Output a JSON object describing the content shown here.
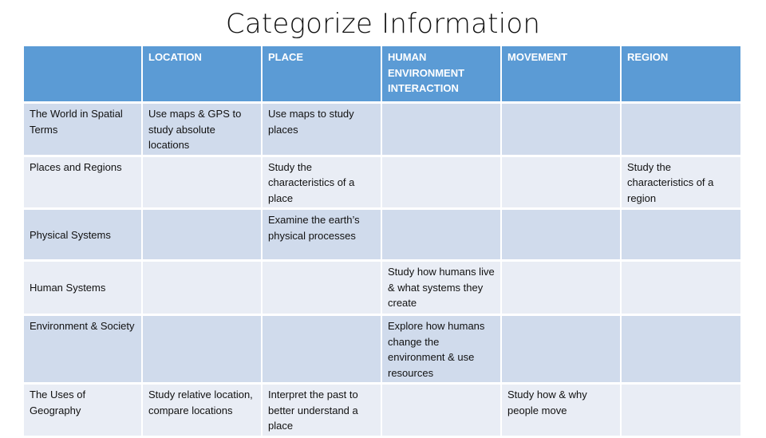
{
  "slide": {
    "title": "Categorize Information"
  },
  "table": {
    "headers": [
      "",
      "LOCATION",
      "PLACE",
      "HUMAN ENVIRONMENT INTERACTION",
      "MOVEMENT",
      "REGION"
    ],
    "rows": [
      {
        "category": "The World in Spatial Terms",
        "cells": [
          "Use maps & GPS to study absolute locations",
          "Use maps to study places",
          "",
          "",
          ""
        ]
      },
      {
        "category": "Places and Regions",
        "cells": [
          "",
          "Study the characteristics of a place",
          "",
          "",
          "Study the characteristics of a region"
        ]
      },
      {
        "category": "Physical Systems",
        "cells": [
          "",
          "Examine the earth’s physical processes",
          "",
          "",
          ""
        ]
      },
      {
        "category": "Human Systems",
        "cells": [
          "",
          "",
          "Study how humans live & what systems they create",
          "",
          ""
        ]
      },
      {
        "category": "Environment & Society",
        "cells": [
          "",
          "",
          "Explore how humans change the environment & use resources",
          "",
          ""
        ]
      },
      {
        "category": "The Uses of Geography",
        "cells": [
          "Study relative location, compare locations",
          "Interpret the past to better understand a place",
          "",
          "Study how & why people move",
          ""
        ]
      }
    ]
  },
  "colors": {
    "header_bg": "#5b9bd5",
    "row_odd_bg": "#d0dbec",
    "row_even_bg": "#e9edf5"
  }
}
